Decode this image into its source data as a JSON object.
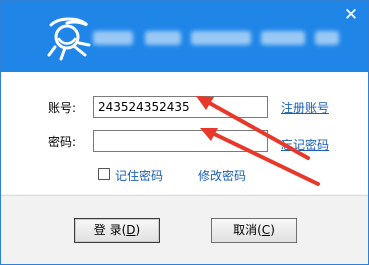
{
  "window": {
    "close_glyph": "✕"
  },
  "form": {
    "account_label": "账号:",
    "account_value": "243524352435",
    "password_label": "密码:",
    "password_value": "",
    "register_link": "注册账号",
    "forgot_link": "忘记密码",
    "remember_label": "记住密码",
    "remember_checked": false,
    "change_password_link": "修改密码"
  },
  "buttons": {
    "login_label": "登 录(",
    "login_key": "D",
    "login_close": ")",
    "cancel_label": "取消(",
    "cancel_key": "C",
    "cancel_close": ")"
  },
  "colors": {
    "titlebar": "#1f86e8",
    "link": "#1a5fb4",
    "annotation_arrow": "#e8382a"
  }
}
